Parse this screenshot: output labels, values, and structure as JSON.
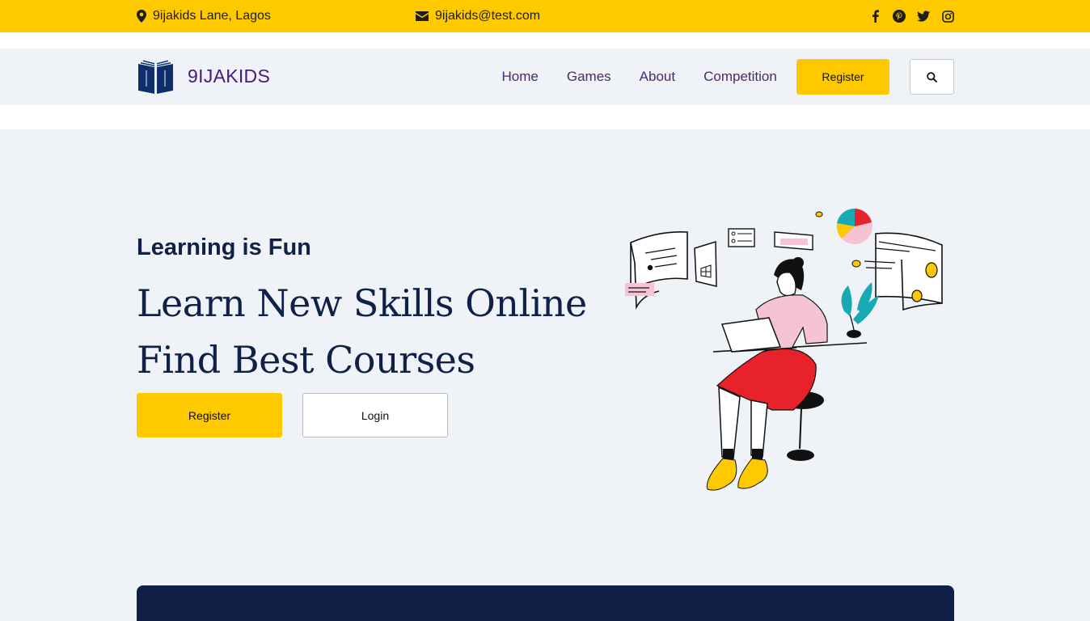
{
  "topbar": {
    "address": "9ijakids Lane, Lagos",
    "email": "9ijakids@test.com",
    "social": [
      "facebook-icon",
      "pinterest-icon",
      "twitter-icon",
      "instagram-icon"
    ]
  },
  "nav": {
    "brand": "9IJAKIDS",
    "links": [
      "Home",
      "Games",
      "About",
      "Competition"
    ],
    "register": "Register"
  },
  "hero": {
    "subtitle": "Learning is Fun",
    "line1": "Learn New Skills Online",
    "line2": "Find Best Courses",
    "register": "Register",
    "login": "Login"
  },
  "colors": {
    "accent": "#ffc900",
    "navy": "#0f2147",
    "brand_purple": "#4a1a7a",
    "hero_bg": "#eff2f7"
  }
}
